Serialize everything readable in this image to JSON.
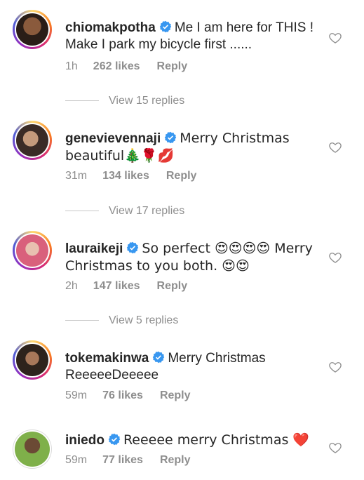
{
  "comments": [
    {
      "username": "chiomakpotha",
      "text": "Me I am here for THIS ! Make I park my bicycle first ......",
      "time": "1h",
      "likes": "262 likes",
      "reply": "Reply",
      "avatar_color": "#3b2a22",
      "view_replies": "View 15 replies"
    },
    {
      "username": "genevievennaji",
      "text": "Merry Christmas beautiful🎄🌹💋",
      "time": "31m",
      "likes": "134 likes",
      "reply": "Reply",
      "avatar_color": "#4a3a34",
      "view_replies": "View 17 replies"
    },
    {
      "username": "lauraikeji",
      "text": "So perfect 😍😍😍😍 Merry Christmas to you both. 😍😍",
      "time": "2h",
      "likes": "147 likes",
      "reply": "Reply",
      "avatar_color": "#d9607c",
      "view_replies": "View 5 replies"
    },
    {
      "username": "tokemakinwa",
      "text": "Merry Christmas ReeeeeDeeeee",
      "time": "59m",
      "likes": "76 likes",
      "reply": "Reply",
      "avatar_color": "#3d2e25"
    },
    {
      "username": "iniedo",
      "text": "Reeeee merry Christmas ❤️",
      "time": "59m",
      "likes": "77 likes",
      "reply": "Reply",
      "avatar_color": "#7fb04a"
    }
  ],
  "icons": {
    "verified": "verified-badge-icon",
    "like": "heart-outline-icon"
  },
  "colors": {
    "verified_blue": "#3897f0",
    "muted": "#8e8e8e",
    "text": "#262626"
  }
}
